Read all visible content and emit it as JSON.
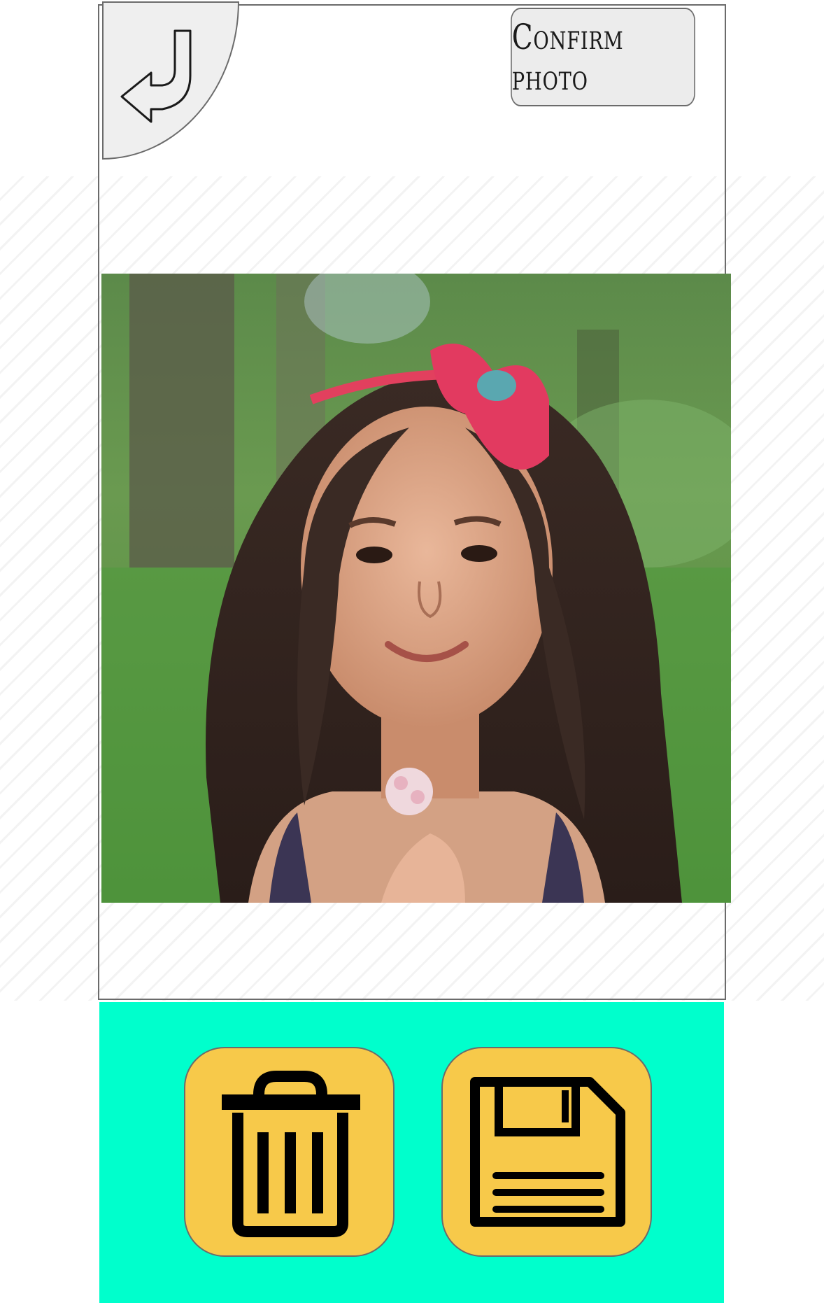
{
  "header": {
    "confirm_label": "Confirm photo",
    "back_icon": "return-arrow-icon"
  },
  "photo": {
    "subject": "photo-preview"
  },
  "actions": {
    "delete_icon": "trash-icon",
    "save_icon": "floppy-disk-icon"
  },
  "colors": {
    "bottom_bar": "#00ffcc",
    "action_button": "#f7c94a",
    "top_button": "#ececec",
    "border": "#6b6b6b",
    "icon": "#000000"
  }
}
